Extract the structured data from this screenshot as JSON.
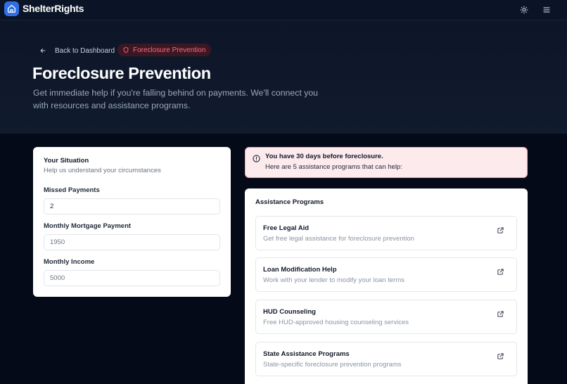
{
  "header": {
    "brand": "ShelterRights",
    "icons": [
      "home-icon",
      "sun-icon",
      "menu-icon"
    ]
  },
  "hero": {
    "back_label": "Back to Dashboard",
    "badge_label": "Foreclosure Prevention",
    "title": "Foreclosure Prevention",
    "subtitle": "Get immediate help if you're falling behind on payments. We'll connect you with resources and assistance programs."
  },
  "situation": {
    "title": "Your Situation",
    "subtitle": "Help us understand your circumstances",
    "fields": [
      {
        "label": "Missed Payments",
        "value": "2",
        "placeholder": ""
      },
      {
        "label": "Monthly Mortgage Payment",
        "value": "",
        "placeholder": "1950"
      },
      {
        "label": "Monthly Income",
        "value": "",
        "placeholder": "5000"
      }
    ]
  },
  "alert": {
    "title": "You have 30 days before foreclosure.",
    "text": "Here are 5 assistance programs that can help:"
  },
  "programs": {
    "title": "Assistance Programs",
    "items": [
      {
        "name": "Free Legal Aid",
        "description": "Get free legal assistance for foreclosure prevention"
      },
      {
        "name": "Loan Modification Help",
        "description": "Work with your lender to modify your loan terms"
      },
      {
        "name": "HUD Counseling",
        "description": "Free HUD-approved housing counseling services"
      },
      {
        "name": "State Assistance Programs",
        "description": "State-specific foreclosure prevention programs"
      }
    ]
  },
  "colors": {
    "background": "#050a19",
    "accent": "#2f6fe6",
    "danger": "#ff6b7d",
    "alert_bg": "#fdeaec"
  }
}
